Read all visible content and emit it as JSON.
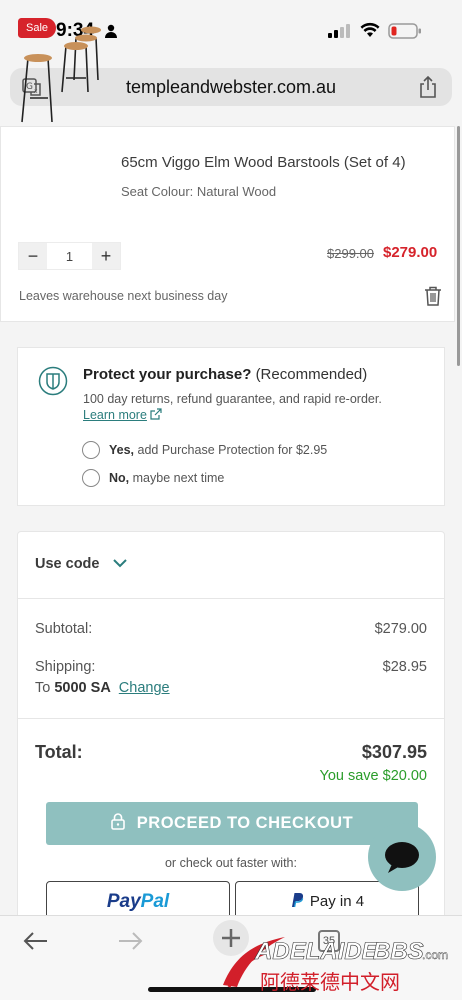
{
  "status_bar": {
    "time": "9:34"
  },
  "browser": {
    "url": "templeandwebster.com.au"
  },
  "product": {
    "badge": "Sale",
    "title": "65cm Viggo Elm Wood Barstools (Set of 4)",
    "variant": "Seat Colour: Natural Wood",
    "quantity": "1",
    "old_price": "$299.00",
    "new_price": "$279.00",
    "shipping_note": "Leaves warehouse next business day"
  },
  "protection": {
    "title": "Protect your purchase?",
    "title_suffix": "(Recommended)",
    "description": "100 day returns, refund guarantee, and rapid re-order.",
    "learn_more": "Learn more",
    "option_yes_bold": "Yes,",
    "option_yes_text": "add Purchase Protection for $2.95",
    "option_no_bold": "No,",
    "option_no_text": "maybe next time"
  },
  "summary": {
    "use_code": "Use code",
    "subtotal_label": "Subtotal:",
    "subtotal_value": "$279.00",
    "shipping_label": "Shipping:",
    "shipping_value": "$28.95",
    "ship_to_prefix": "To",
    "ship_to_location": "5000 SA",
    "change_link": "Change",
    "total_label": "Total:",
    "total_value": "$307.95",
    "savings": "You save $20.00",
    "checkout_button": "PROCEED TO CHECKOUT",
    "faster_text": "or check out faster with:",
    "paypal_a": "Pay",
    "paypal_b": "Pal",
    "payin4": "Pay in 4"
  },
  "bottom_bar": {
    "tab_count": "35"
  },
  "watermark": {
    "brand": "ADELAIDEBBS.com",
    "chinese": "阿德莱德中文网"
  },
  "colors": {
    "accent": "#8fc0bf",
    "link": "#2b7d7d",
    "sale": "#d6232b",
    "savings": "#2a9d2a"
  }
}
